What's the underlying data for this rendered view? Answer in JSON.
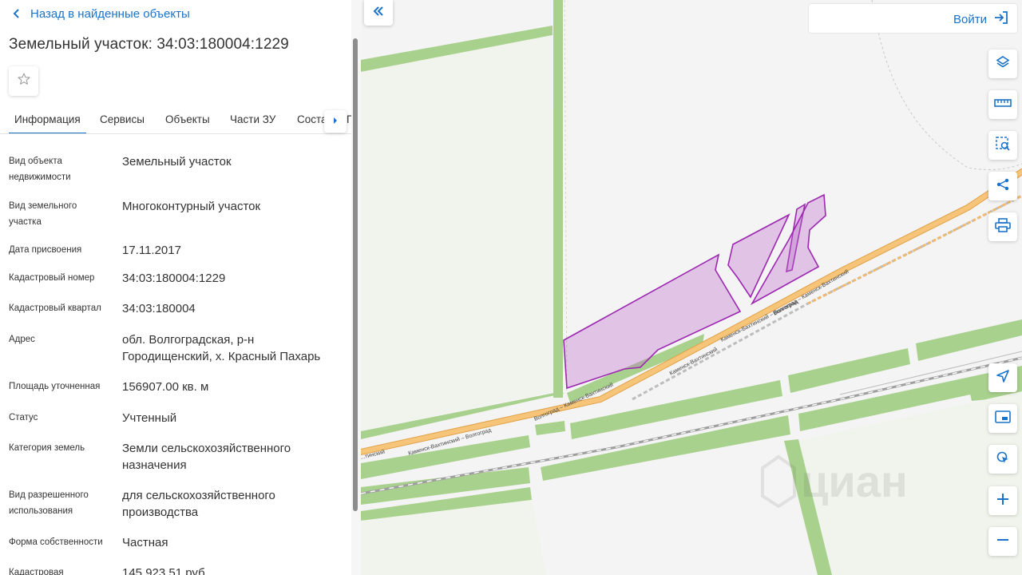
{
  "panel": {
    "back_label": "Назад в найденные объекты",
    "title": "Земельный участок: 34:03:180004:1229",
    "favorite_icon": "star-outline-icon"
  },
  "tabs": [
    {
      "label": "Информация",
      "active": true
    },
    {
      "label": "Сервисы",
      "active": false
    },
    {
      "label": "Объекты",
      "active": false
    },
    {
      "label": "Части ЗУ",
      "active": false
    },
    {
      "label": "Соста",
      "active": false
    },
    {
      "label": "П",
      "active": false
    }
  ],
  "info": [
    {
      "label": "Вид объекта недвижимости",
      "value": "Земельный участок"
    },
    {
      "label": "Вид земельного участка",
      "value": "Многоконтурный участок"
    },
    {
      "label": "Дата присвоения",
      "value": "17.11.2017"
    },
    {
      "label": "Кадастровый номер",
      "value": "34:03:180004:1229"
    },
    {
      "label": "Кадастровый квартал",
      "value": "34:03:180004"
    },
    {
      "label": "Адрес",
      "value": "обл. Волгоградская, р-н Городищенский, х. Красный Пахарь"
    },
    {
      "label": "Площадь уточненная",
      "value": "156907.00 кв. м"
    },
    {
      "label": "Статус",
      "value": "Учтенный"
    },
    {
      "label": "Категория земель",
      "value": "Земли сельскохозяйственного назначения"
    },
    {
      "label": "Вид разрешенного использования",
      "value": "для сельскохозяйственного производства"
    },
    {
      "label": "Форма собственности",
      "value": "Частная"
    },
    {
      "label": "Кадастровая",
      "value": "145 923.51 руб."
    }
  ],
  "map": {
    "login_label": "Войти",
    "road_labels": [
      "Волгоград – Каменск-Вахтинский",
      "Каменск-Вахтинский – Волгоград",
      "Каменск-Вахтинский",
      "Волгоград – Каменск-Вахтинский",
      "Каменск-Вахтинский – Волгоград",
      "...тинский"
    ],
    "watermark": "циан",
    "parcel_color": "#9c27b0",
    "accent_color": "#1a73c9",
    "tools": [
      "layers-icon",
      "ruler-icon",
      "area-select-icon",
      "share-icon",
      "print-icon",
      "navigate-icon",
      "minimap-icon",
      "geolocation-icon",
      "zoom-in-icon",
      "zoom-out-icon"
    ]
  }
}
